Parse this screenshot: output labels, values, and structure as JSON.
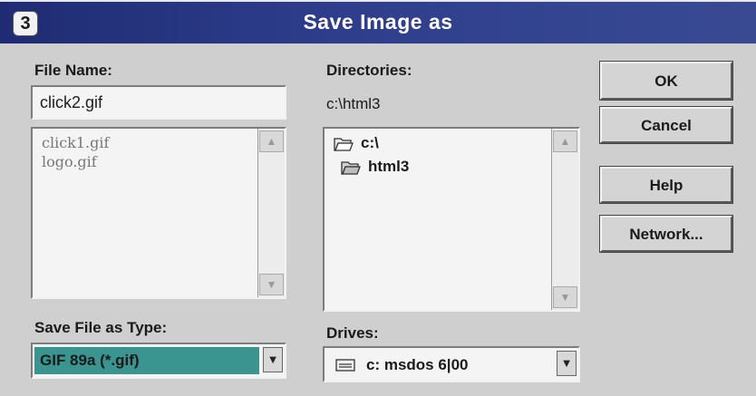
{
  "window": {
    "badge": "3",
    "title": "Save Image as"
  },
  "file_name": {
    "label": "File Name:",
    "value": "click2.gif",
    "files": [
      "click1.gif",
      "logo.gif"
    ]
  },
  "directories": {
    "label": "Directories:",
    "current_path": "c:\\html3",
    "items": [
      "c:\\",
      "html3"
    ]
  },
  "save_type": {
    "label": "Save File as Type:",
    "value": "GIF 89a (*.gif)"
  },
  "drives": {
    "label": "Drives:",
    "value": "c: msdos 6|00"
  },
  "buttons": {
    "ok": "OK",
    "cancel": "Cancel",
    "help": "Help",
    "network": "Network..."
  },
  "colors": {
    "titlebar": "#2e3e8c",
    "selection": "#3a9490"
  },
  "icons": {
    "folder_open": "folder-open-icon",
    "drive": "drive-icon",
    "scroll_arrow": "arrow-icon"
  }
}
